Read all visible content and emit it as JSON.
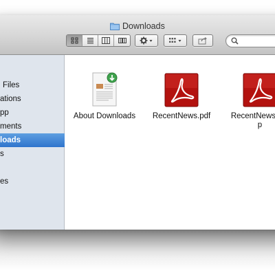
{
  "window": {
    "title": "Downloads"
  },
  "toolbar": {
    "view_buttons": [
      "icon-view",
      "list-view",
      "column-view",
      "cover-flow-view"
    ],
    "action_icon": "gear-icon",
    "arrange_icon": "grid-icon",
    "share_icon": "share-icon",
    "search_placeholder": ""
  },
  "sidebar": {
    "items": [
      {
        "label": "Files"
      },
      {
        "label": "ations"
      },
      {
        "label": "pp"
      },
      {
        "label": "ments"
      },
      {
        "label": "loads",
        "selected": true
      },
      {
        "label": "s"
      },
      {
        "label": ""
      },
      {
        "label": "es"
      }
    ]
  },
  "files": [
    {
      "name": "About Downloads",
      "icon": "document-icon"
    },
    {
      "name": "RecentNews.pdf",
      "icon": "pdf-icon"
    },
    {
      "name": "RecentNews.pdf",
      "name_line2": "p",
      "icon": "pdf-icon"
    }
  ],
  "colors": {
    "sidebar_bg": "#dfe5ed",
    "selection": "#2f74cd",
    "pdf_red": "#b3120f"
  }
}
